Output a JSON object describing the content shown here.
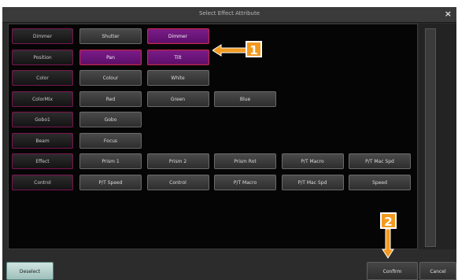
{
  "window": {
    "title": "Select Effect Attribute",
    "close_glyph": "×"
  },
  "categories": [
    {
      "label": "Dimmer",
      "attributes": [
        {
          "label": "Shutter",
          "selected": false
        },
        {
          "label": "Dimmer",
          "selected": true
        }
      ]
    },
    {
      "label": "Position",
      "attributes": [
        {
          "label": "Pan",
          "selected": true
        },
        {
          "label": "Tilt",
          "selected": true
        }
      ]
    },
    {
      "label": "Color",
      "attributes": [
        {
          "label": "Colour",
          "selected": false
        },
        {
          "label": "White",
          "selected": false
        }
      ]
    },
    {
      "label": "ColorMix",
      "attributes": [
        {
          "label": "Red",
          "selected": false
        },
        {
          "label": "Green",
          "selected": false
        },
        {
          "label": "Blue",
          "selected": false
        }
      ]
    },
    {
      "label": "Gobo1",
      "attributes": [
        {
          "label": "Gobo",
          "selected": false
        }
      ]
    },
    {
      "label": "Beam",
      "attributes": [
        {
          "label": "Focus",
          "selected": false
        }
      ]
    },
    {
      "label": "Effect",
      "attributes": [
        {
          "label": "Prism 1",
          "selected": false
        },
        {
          "label": "Prism 2",
          "selected": false
        },
        {
          "label": "Prism Rot",
          "selected": false
        },
        {
          "label": "P/T Macro",
          "selected": false
        },
        {
          "label": "P/T Mac Spd",
          "selected": false
        }
      ]
    },
    {
      "label": "Control",
      "attributes": [
        {
          "label": "P/T Speed",
          "selected": false
        },
        {
          "label": "Control",
          "selected": false
        },
        {
          "label": "P/T Macro",
          "selected": false
        },
        {
          "label": "P/T Mac Spd",
          "selected": false
        },
        {
          "label": "Speed",
          "selected": false
        }
      ]
    }
  ],
  "footer": {
    "deselect_label": "Deselect",
    "confirm_label": "Confirm",
    "cancel_label": "Cancel"
  },
  "annotations": {
    "marker_1": "1",
    "marker_2": "2",
    "accent_color": "#f29a1f"
  }
}
